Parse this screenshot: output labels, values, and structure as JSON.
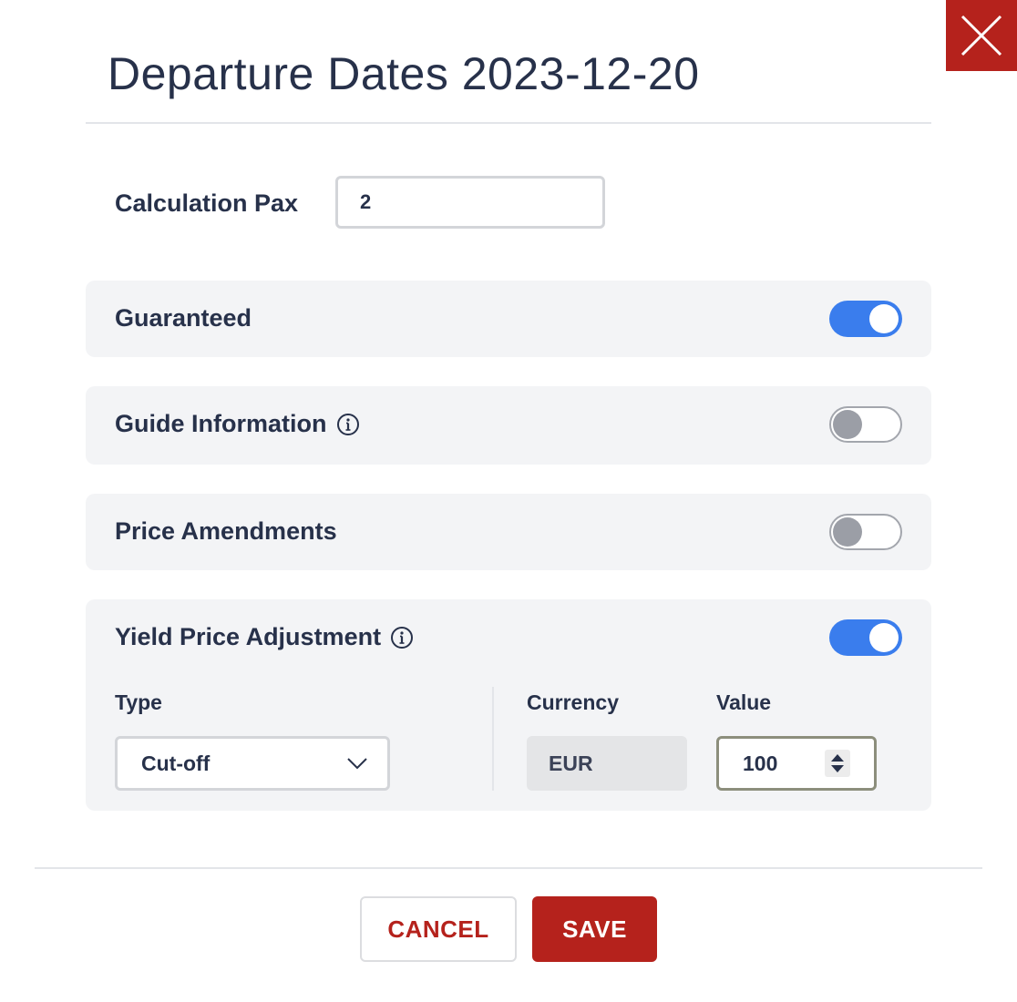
{
  "dialog": {
    "title": "Departure Dates 2023-12-20",
    "close_icon": "close-icon"
  },
  "calculation_pax": {
    "label": "Calculation Pax",
    "value": "2"
  },
  "sections": {
    "guaranteed": {
      "label": "Guaranteed",
      "enabled": true
    },
    "guide_information": {
      "label": "Guide Information",
      "enabled": false,
      "icon": "info-icon"
    },
    "price_amendments": {
      "label": "Price Amendments",
      "enabled": false
    },
    "yield_price_adjustment": {
      "label": "Yield Price Adjustment",
      "enabled": true,
      "icon": "info-icon",
      "type_label": "Type",
      "type_value": "Cut-off",
      "currency_label": "Currency",
      "currency_value": "EUR",
      "value_label": "Value",
      "value": "100"
    }
  },
  "footer": {
    "cancel_label": "CANCEL",
    "save_label": "SAVE"
  },
  "colors": {
    "accent_red": "#b5221c",
    "toggle_on": "#3a7ded",
    "text_dark": "#27314a"
  }
}
